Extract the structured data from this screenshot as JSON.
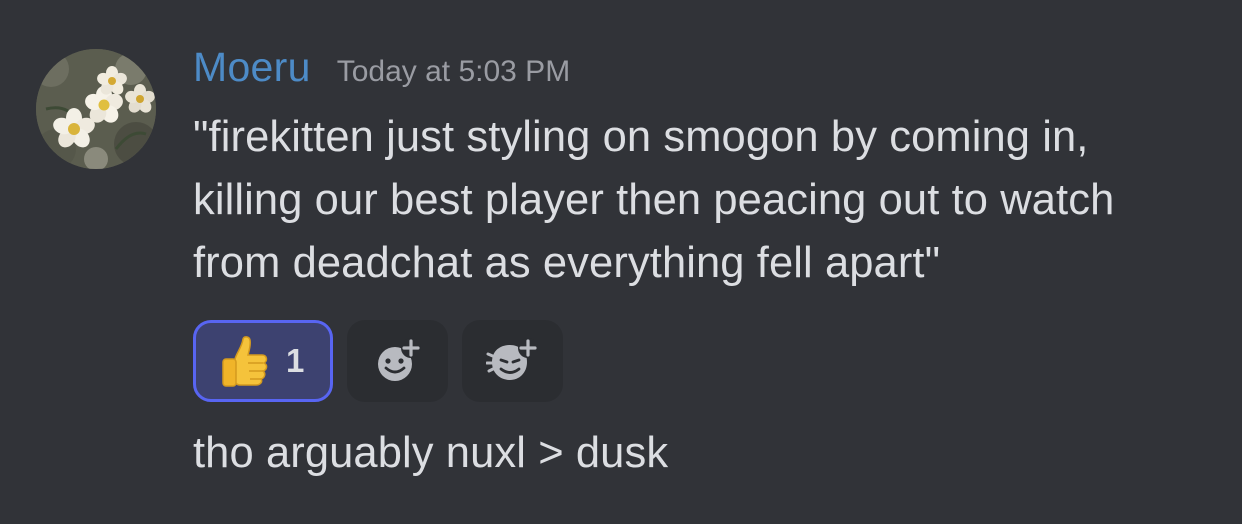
{
  "author": {
    "name": "Moeru",
    "name_color": "#4d8bc7",
    "avatar_icon": "white-flowers-avatar"
  },
  "timestamp": "Today at 5:03 PM",
  "message": {
    "line1": "\"firekitten just styling on smogon by coming in,",
    "line2": "killing our best player then peacing out to watch",
    "line3": "from deadchat as everything fell apart\""
  },
  "reactions": [
    {
      "emoji": "thumbs-up-emoji",
      "count": "1",
      "active": true
    },
    {
      "icon": "add-reaction-icon"
    },
    {
      "icon": "add-super-reaction-icon"
    }
  ],
  "followup": "tho arguably nuxl > dusk",
  "colors": {
    "background": "#313338",
    "reaction_active_bg": "#3d4270",
    "reaction_active_border": "#5865f2",
    "text": "#dcdee2",
    "timestamp": "#9a9ca3"
  }
}
